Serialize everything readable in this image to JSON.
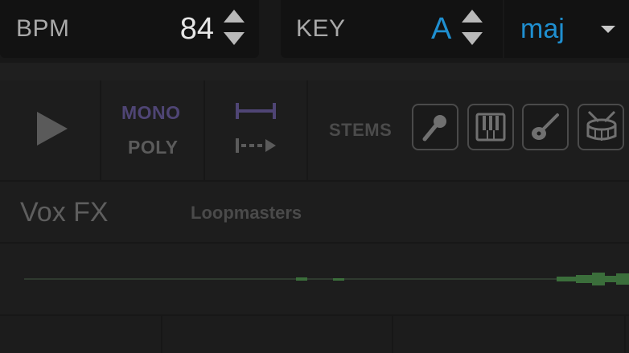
{
  "bpm": {
    "label": "BPM",
    "value": "84"
  },
  "key": {
    "label": "KEY",
    "value": "A",
    "scale": "maj"
  },
  "playback": {
    "mode_options": [
      "MONO",
      "POLY"
    ],
    "active_mode": "MONO"
  },
  "stems": {
    "label": "STEMS",
    "buttons": [
      {
        "name": "vocals",
        "icon": "microphone-icon"
      },
      {
        "name": "keys",
        "icon": "piano-icon"
      },
      {
        "name": "guitar",
        "icon": "guitar-icon"
      },
      {
        "name": "drums",
        "icon": "drum-icon"
      }
    ]
  },
  "sample": {
    "title": "Vox FX",
    "pack": "Loopmasters"
  },
  "colors": {
    "accent_blue": "#1f8fd0",
    "mode_active": "#4f4575",
    "waveform": "#3b6e3b"
  }
}
